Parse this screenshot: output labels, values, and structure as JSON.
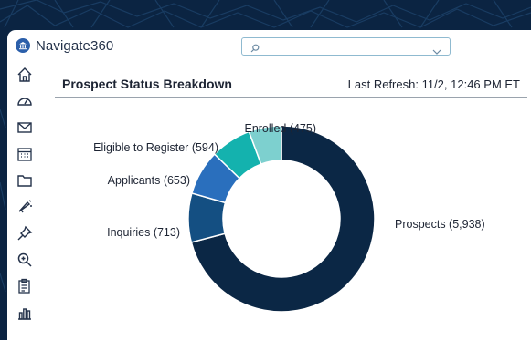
{
  "app": {
    "name": "Navigate360"
  },
  "nav": {
    "items": [
      {
        "icon": "home-icon"
      },
      {
        "icon": "dashboard-gauge-icon"
      },
      {
        "icon": "mail-icon"
      },
      {
        "icon": "calendar-icon"
      },
      {
        "icon": "folder-icon"
      },
      {
        "icon": "megaphone-icon"
      },
      {
        "icon": "pin-icon"
      },
      {
        "icon": "zoom-search-icon"
      },
      {
        "icon": "clipboard-icon"
      },
      {
        "icon": "bar-chart-icon"
      }
    ]
  },
  "header": {
    "title": "Prospect Status Breakdown",
    "last_refresh": "Last Refresh: 11/2, 12:46 PM ET"
  },
  "colors": {
    "background": "#0b2442",
    "prospects": "#0b2745",
    "inquiries": "#144f82",
    "applicants": "#2a6fbd",
    "eligible": "#14b2ae",
    "enrolled": "#7dd0cf"
  },
  "chart_data": {
    "type": "pie",
    "donut": true,
    "categories": [
      "Prospects",
      "Inquiries",
      "Applicants",
      "Eligible to Register",
      "Enrolled"
    ],
    "values": [
      5938,
      713,
      653,
      594,
      475
    ],
    "labels": [
      "Prospects (5,938)",
      "Inquiries (713)",
      "Applicants (653)",
      "Eligible to Register (594)",
      "Enrolled (475)"
    ],
    "colors": [
      "#0b2745",
      "#144f82",
      "#2a6fbd",
      "#14b2ae",
      "#7dd0cf"
    ],
    "title": "Prospect Status Breakdown"
  }
}
